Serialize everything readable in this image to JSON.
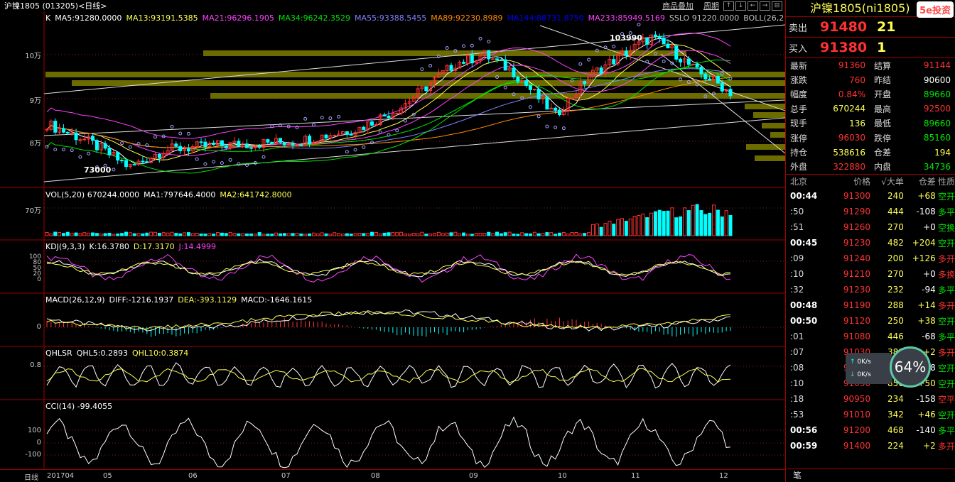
{
  "topbar": {
    "symbol": "沪镍1805 (013205)<日线>",
    "menu_overlay": "商品叠加",
    "menu_period": "周期",
    "arrows": [
      "↑",
      "↓",
      "←",
      "→",
      "⊟"
    ]
  },
  "kline": {
    "k_label": "K",
    "ma": [
      {
        "text": "MA5:91280.0000",
        "color": "#ffffff"
      },
      {
        "text": "MA13:93191.5385",
        "color": "#ffff54"
      },
      {
        "text": "MA21:96296.1905",
        "color": "#ff40ff"
      },
      {
        "text": "MA34:96242.3529",
        "color": "#00e600"
      },
      {
        "text": "MA55:93388.5455",
        "color": "#8080ff"
      },
      {
        "text": "MA89:92230.8989",
        "color": "#ff8c00"
      },
      {
        "text": "MA144:88731.8750",
        "color": "#0000ff"
      },
      {
        "text": "MA233:85949.5169",
        "color": "#ff40ff"
      },
      {
        "text": "SSLO 91220.0000",
        "color": "#c0c0c0"
      },
      {
        "text": "BOLL(26,2",
        "color": "#c0c0c0"
      }
    ],
    "yaxis": [
      "10万",
      "9万",
      "8万"
    ],
    "high_label": "103990",
    "low_label": "73000"
  },
  "volume": {
    "label": "VOL(5,20) 670244.0000",
    "ma1": "MA1:797646.4000",
    "ma2": "MA2:641742.8000",
    "yaxis": "70万"
  },
  "kdj": {
    "label": "KDJ(9,3,3)",
    "k": "K:16.3780",
    "d": "D:17.3170",
    "j": "J:14.4999",
    "yaxis": [
      "100",
      "80",
      "50",
      "20",
      "0"
    ]
  },
  "macd": {
    "label": "MACD(26,12,9)",
    "diff": "DIFF:-1216.1937",
    "dea": "DEA:-393.1129",
    "macd": "MACD:-1646.1615",
    "yaxis": "0"
  },
  "qhlsr": {
    "label": "QHLSR",
    "ql5": "QHL5:0.2893",
    "ql10": "QHL10:0.3874",
    "yaxis": "0.8"
  },
  "cci": {
    "label": "CCI(14) -99.4055",
    "yaxis": [
      "100",
      "0",
      "-100"
    ]
  },
  "xaxis": {
    "period": "日线",
    "ticks": [
      "201704",
      "05",
      "06",
      "07",
      "08",
      "09",
      "10",
      "11",
      "12"
    ]
  },
  "right": {
    "title": "沪镍1805(ni1805)",
    "logo": "5e投资",
    "sell": {
      "label": "卖出",
      "price": "91480",
      "qty": "21"
    },
    "buy": {
      "label": "买入",
      "price": "91380",
      "qty": "1"
    },
    "quote": [
      {
        "k": "最新",
        "v": "91360",
        "vc": "red",
        "k2": "结算",
        "v2": "91144",
        "v2c": "red"
      },
      {
        "k": "涨跌",
        "v": "760",
        "vc": "red",
        "k2": "昨结",
        "v2": "90600",
        "v2c": "wht"
      },
      {
        "k": "幅度",
        "v": "0.84%",
        "vc": "red",
        "k2": "开盘",
        "v2": "89660",
        "v2c": "grn"
      },
      {
        "k": "总手",
        "v": "670244",
        "vc": "yel",
        "k2": "最高",
        "v2": "92500",
        "v2c": "red"
      },
      {
        "k": "现手",
        "v": "136",
        "vc": "yel",
        "k2": "最低",
        "v2": "89660",
        "v2c": "grn"
      },
      {
        "k": "涨停",
        "v": "96030",
        "vc": "red",
        "k2": "跌停",
        "v2": "85160",
        "v2c": "grn"
      },
      {
        "k": "持仓",
        "v": "538616",
        "vc": "yel",
        "k2": "仓差",
        "v2": "194",
        "v2c": "yel"
      },
      {
        "k": "外盘",
        "v": "322880",
        "vc": "red",
        "k2": "内盘",
        "v2": "34736",
        "v2c": "grn"
      }
    ],
    "thead": [
      "北京",
      "价格",
      "√大单",
      "仓差",
      "性质"
    ],
    "trades": [
      {
        "t": "00:44",
        "p": "91300",
        "q": "240",
        "d": "+68",
        "n": "空开",
        "pc": "red",
        "dc": "yel",
        "nc": "grn",
        "bold": true
      },
      {
        "t": ":50",
        "p": "91290",
        "q": "444",
        "d": "-108",
        "n": "多平",
        "pc": "red",
        "dc": "wht",
        "nc": "grn",
        "bold": false
      },
      {
        "t": ":51",
        "p": "91260",
        "q": "270",
        "d": "+0",
        "n": "空换",
        "pc": "red",
        "dc": "wht",
        "nc": "grn",
        "bold": false
      },
      {
        "t": "00:45",
        "p": "91230",
        "q": "482",
        "d": "+204",
        "n": "空开",
        "pc": "red",
        "dc": "yel",
        "nc": "grn",
        "bold": true
      },
      {
        "t": ":09",
        "p": "91240",
        "q": "200",
        "d": "+126",
        "n": "多开",
        "pc": "red",
        "dc": "yel",
        "nc": "red",
        "bold": false
      },
      {
        "t": ":10",
        "p": "91210",
        "q": "270",
        "d": "+0",
        "n": "多换",
        "pc": "red",
        "dc": "wht",
        "nc": "red",
        "bold": false
      },
      {
        "t": ":32",
        "p": "91230",
        "q": "232",
        "d": "-94",
        "n": "多平",
        "pc": "red",
        "dc": "wht",
        "nc": "grn",
        "bold": false
      },
      {
        "t": "00:48",
        "p": "91190",
        "q": "288",
        "d": "+14",
        "n": "多开",
        "pc": "red",
        "dc": "yel",
        "nc": "red",
        "bold": true
      },
      {
        "t": "00:50",
        "p": "91120",
        "q": "250",
        "d": "+38",
        "n": "空开",
        "pc": "red",
        "dc": "yel",
        "nc": "grn",
        "bold": true
      },
      {
        "t": ":01",
        "p": "91080",
        "q": "446",
        "d": "-68",
        "n": "多平",
        "pc": "red",
        "dc": "wht",
        "nc": "grn",
        "bold": false
      },
      {
        "t": ":07",
        "p": "91030",
        "q": "388",
        "d": "+2",
        "n": "多开",
        "pc": "red",
        "dc": "yel",
        "nc": "red",
        "bold": false
      },
      {
        "t": ":08",
        "p": "91010",
        "q": "348",
        "d": "-58",
        "n": "空开",
        "pc": "red",
        "dc": "wht",
        "nc": "grn",
        "bold": false
      },
      {
        "t": ":10",
        "p": "91030",
        "q": "850",
        "d": "+50",
        "n": "空开",
        "pc": "red",
        "dc": "yel",
        "nc": "grn",
        "bold": false
      },
      {
        "t": ":18",
        "p": "90950",
        "q": "234",
        "d": "-158",
        "n": "空平",
        "pc": "red",
        "dc": "wht",
        "nc": "red",
        "bold": false
      },
      {
        "t": ":53",
        "p": "91010",
        "q": "342",
        "d": "+46",
        "n": "空开",
        "pc": "red",
        "dc": "yel",
        "nc": "grn",
        "bold": false
      },
      {
        "t": "00:56",
        "p": "91200",
        "q": "468",
        "d": "-140",
        "n": "多平",
        "pc": "red",
        "dc": "wht",
        "nc": "grn",
        "bold": true
      },
      {
        "t": "00:59",
        "p": "91400",
        "q": "224",
        "d": "+2",
        "n": "多开",
        "pc": "red",
        "dc": "yel",
        "nc": "red",
        "bold": true
      }
    ],
    "footer_tab": "笔",
    "net": {
      "up": "0K/s",
      "down": "0K/s"
    },
    "gauge": "64%"
  }
}
